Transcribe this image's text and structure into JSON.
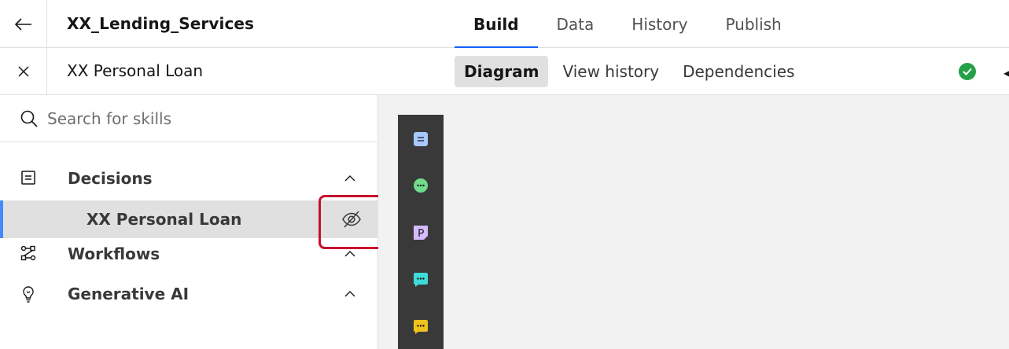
{
  "header": {
    "title": "XX_Lending_Services",
    "tabs": [
      {
        "label": "Build",
        "active": true
      },
      {
        "label": "Data",
        "active": false
      },
      {
        "label": "History",
        "active": false
      },
      {
        "label": "Publish",
        "active": false
      }
    ]
  },
  "subheader": {
    "title": "XX Personal Loan",
    "tabs": [
      {
        "label": "Diagram",
        "active": true
      },
      {
        "label": "View history",
        "active": false
      },
      {
        "label": "Dependencies",
        "active": false
      }
    ],
    "status_icon": "checkmark-filled-icon",
    "status_color": "#24a148"
  },
  "sidebar": {
    "search": {
      "placeholder": "Search for skills",
      "value": ""
    },
    "sections": [
      {
        "label": "Decisions",
        "icon": "decision-icon",
        "expanded": true,
        "items": [
          {
            "label": "XX Personal Loan",
            "selected": true,
            "action_icon": "view-off-icon"
          }
        ]
      },
      {
        "label": "Workflows",
        "icon": "workflow-icon",
        "expanded": true,
        "items": []
      },
      {
        "label": "Generative AI",
        "icon": "generative-ai-icon",
        "expanded": true,
        "items": []
      }
    ],
    "selection_accent": "#4589ff",
    "annotation_color": "#c8102e"
  },
  "palette": {
    "items": [
      {
        "icon": "decision-node-icon",
        "color": "#a6c8ff"
      },
      {
        "icon": "function-node-icon",
        "color": "#6fdc8c"
      },
      {
        "icon": "prediction-node-icon",
        "color": "#d4bbff"
      },
      {
        "icon": "external-node-icon",
        "color": "#3ddbd9"
      },
      {
        "icon": "input-node-icon",
        "color": "#f1c21b"
      }
    ]
  }
}
